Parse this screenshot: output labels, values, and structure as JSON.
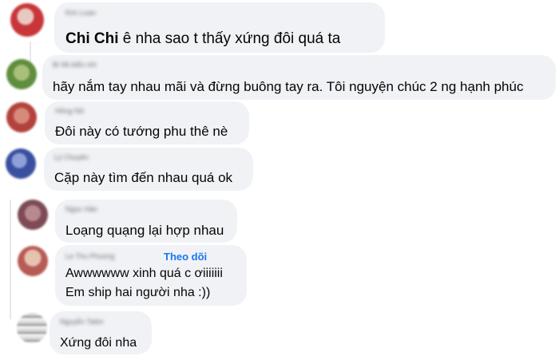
{
  "comments": [
    {
      "author": "Kim Loan",
      "mention": "Chi Chi",
      "text": " ê nha sao t thấy xứng đôi quá ta"
    },
    {
      "author": "Bí Mị biểu nhì",
      "text": "hãy nắm tay nhau mãi và đừng buông tay ra. Tôi nguyện chúc 2 ng hạnh phúc"
    },
    {
      "author": "Hồng Nữ",
      "text": "Đôi này có tướng phu thê nè"
    },
    {
      "author": "Lý Chuyên",
      "text": "Cặp này tìm đến nhau quá ok"
    },
    {
      "author": "Ngọc Hân",
      "text": "Loạng quạng lại hợp nhau"
    },
    {
      "author": "Le Thu Phuong",
      "follow_label": "Theo dõi",
      "text_line1": "Awwwwww xinh quá c ơiiiiiii",
      "text_line2": "Em ship hai người nha :))"
    },
    {
      "author": "Nguyễn Tailor",
      "text": "Xứng đôi nha"
    }
  ],
  "colors": {
    "bubble": "#f0f2f5",
    "text": "#050505",
    "link": "#1877f2"
  }
}
